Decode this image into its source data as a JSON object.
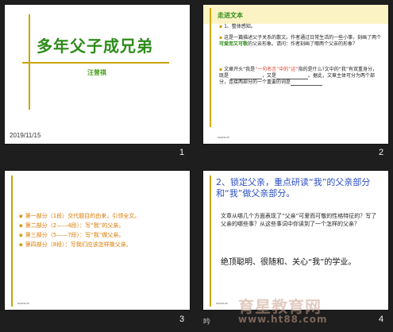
{
  "slides": [
    {
      "number": "1",
      "title": "多年父子成兄弟",
      "author": "汪曾祺",
      "date": "2019/11/15"
    },
    {
      "number": "2",
      "section_label": "走进文本",
      "point1": "1、整体感知。",
      "point2_a": "这是一篇描述父子关系的散文。作者通过日常生活的一些小事，刻画了两个",
      "point2_highlight": "可爱而又可敬",
      "point2_b": "的父亲形象。请问：作者刻画了哪两个父亲的形象？",
      "point3_a": "文章开头“我是",
      "point3_quote": "“一句名言”中的“这”",
      "point3_b": "指的是什么?文中的“我”有双重身分，既是",
      "point3_c": "，又是",
      "point3_d": "。据此，文章主体可分为两个部分，连接两部分的一个重要的词是",
      "date": "2019/11/15"
    },
    {
      "number": "3",
      "items": [
        "第一部分（1段）交代题目的由来，引领全文。",
        "第二部分（2——4段）：写“我”的父亲。",
        "第三部分（5——7段）：写“我”做父亲。",
        "第四部分（8段）：写我们应该怎样做父亲。"
      ],
      "date": "2019/11/15"
    },
    {
      "number": "4",
      "heading": "2、锁定父亲，重点研读“我”的父亲部分和“我”做父亲部分。",
      "question": "文章从哪几个方面表现了“父亲”可爱而可敬的性格特征的？写了父亲的哪些事？从这些事词中你读到了一个怎样的父亲？",
      "answer": "绝顶聪明、很随和、关心“我”的学业。",
      "date": "2019/11/15"
    }
  ],
  "watermark": {
    "line1": "育星教育网",
    "line2": "www.ht88.com"
  },
  "stray_text": "吟"
}
